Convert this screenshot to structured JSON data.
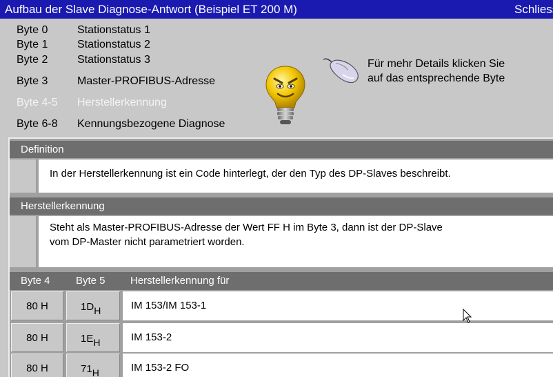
{
  "window": {
    "title": "Aufbau der Slave Diagnose-Antwort (Beispiel ET 200 M)",
    "close_label": "Schliessen"
  },
  "bytes": [
    {
      "byte": "Byte 0",
      "label": "Stationstatus 1"
    },
    {
      "byte": "Byte 1",
      "label": "Stationstatus 2"
    },
    {
      "byte": "Byte 2",
      "label": "Stationstatus 3"
    },
    {
      "byte": "Byte 3",
      "label": "Master-PROFIBUS-Adresse"
    },
    {
      "byte": "Byte 4-5",
      "label": "Herstellerkennung"
    },
    {
      "byte": "Byte 6-8",
      "label": "Kennungsbezogene Diagnose"
    }
  ],
  "active_byte_index": 4,
  "hint": {
    "line1": "Für mehr Details klicken Sie",
    "line2": "auf das entsprechende Byte"
  },
  "definition": {
    "header": "Definition",
    "text": "In der Herstellerkennung ist ein Code hinterlegt, der den Typ des DP-Slaves beschreibt."
  },
  "herstellerkennung": {
    "header": "Herstellerkennung",
    "line1": "Steht als Master-PROFIBUS-Adresse der Wert FF H im Byte 3, dann ist der DP-Slave",
    "line2": "vom DP-Master nicht parametriert worden."
  },
  "table": {
    "columns": [
      "Byte 4",
      "Byte 5",
      "Herstellerkennung für"
    ],
    "rows": [
      {
        "byte4": "80 H",
        "byte5": "1D",
        "byte5_sub": "H",
        "device": "IM 153/IM 153-1"
      },
      {
        "byte4": "80 H",
        "byte5": "1E",
        "byte5_sub": "H",
        "device": "IM 153-2"
      },
      {
        "byte4": "80 H",
        "byte5": "71",
        "byte5_sub": "H",
        "device": "IM 153-2 FO"
      }
    ]
  },
  "colors": {
    "titlebar": "#1a1ab0",
    "background": "#c8c8c8",
    "section_header": "#6e6e6e"
  }
}
